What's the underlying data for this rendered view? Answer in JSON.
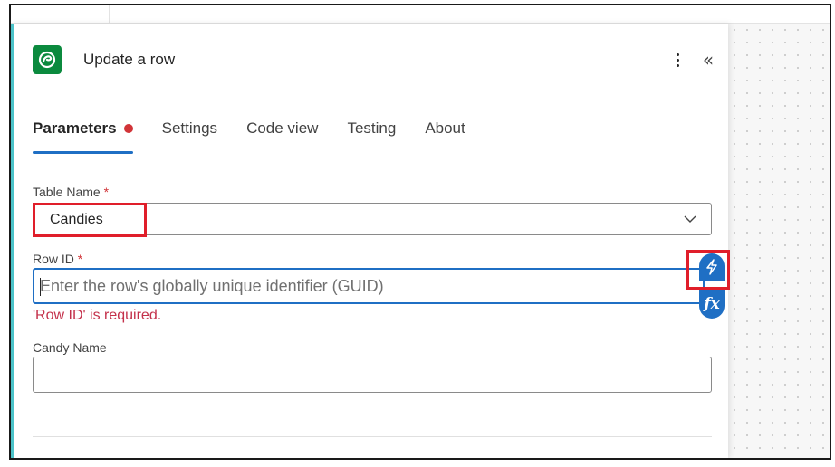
{
  "action": {
    "title": "Update a row",
    "icon": "dataverse-icon",
    "brand_color": "#0b8a3e",
    "more_icon": "more-vertical-icon",
    "collapse_icon": "double-chevron-left-icon",
    "collapse_glyph": "«"
  },
  "tabs": [
    {
      "label": "Parameters",
      "active": true,
      "error_dot": true
    },
    {
      "label": "Settings"
    },
    {
      "label": "Code view"
    },
    {
      "label": "Testing"
    },
    {
      "label": "About"
    }
  ],
  "fields": {
    "table_name": {
      "label": "Table Name",
      "required_mark": "*",
      "value": "Candies"
    },
    "row_id": {
      "label": "Row ID",
      "required_mark": "*",
      "value": "",
      "placeholder": "Enter the row's globally unique identifier (GUID)",
      "error": "'Row ID' is required."
    },
    "candy_name": {
      "label": "Candy Name",
      "value": ""
    }
  },
  "input_tools": {
    "dynamic_content_icon": "lightning-icon",
    "expression_icon": "fx-icon",
    "expression_label": "fx"
  },
  "colors": {
    "accent": "#1f6fc4",
    "error": "#c4314b",
    "highlight": "#e01e2a",
    "panel_edge": "#4cc3c9"
  }
}
